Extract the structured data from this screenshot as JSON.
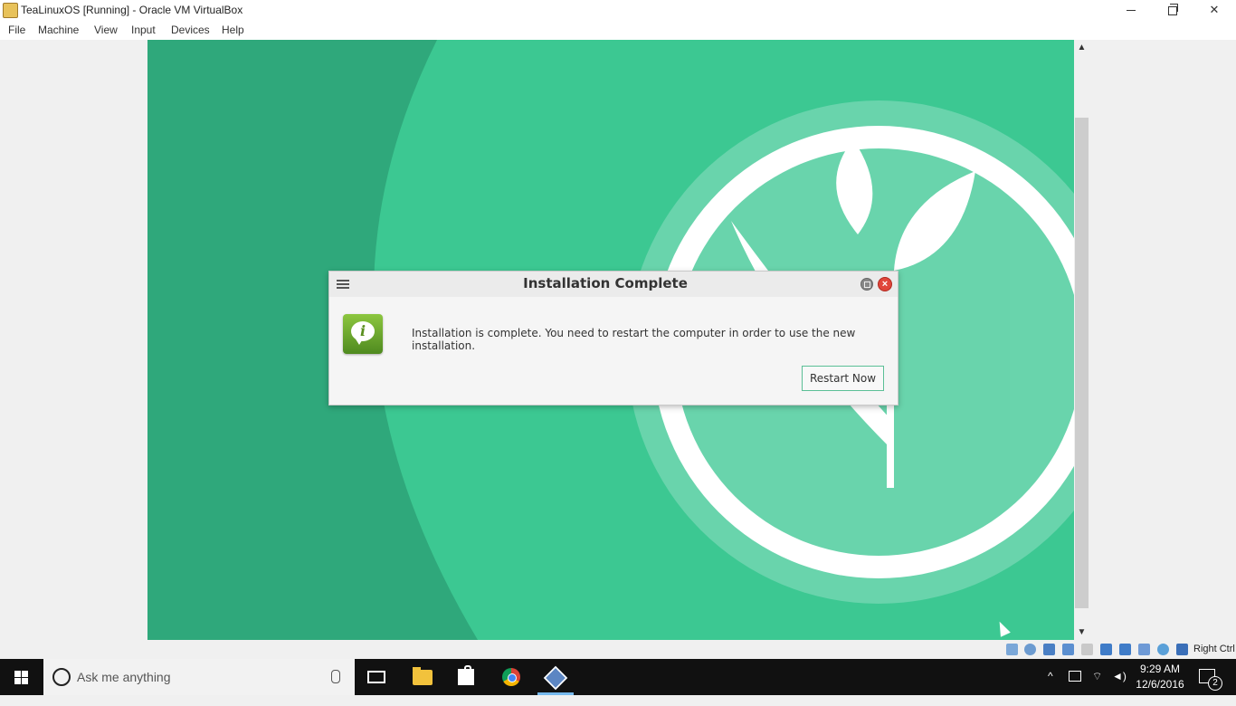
{
  "window": {
    "title": "TeaLinuxOS [Running] - Oracle VM VirtualBox",
    "minimize_label": "",
    "maximize_label": "",
    "close_label": "✕"
  },
  "menubar": {
    "items": [
      "File",
      "Machine",
      "View",
      "Input",
      "Devices",
      "Help"
    ]
  },
  "dialog": {
    "title": "Installation Complete",
    "message": "Installation is complete. You need to restart the computer in order to use the new installation.",
    "restart_button": "Restart Now",
    "close_glyph": "×",
    "icon_letter": "i"
  },
  "vbox_status": {
    "host_key": "Right Ctrl"
  },
  "taskbar": {
    "search_placeholder": "Ask me anything",
    "time": "9:29 AM",
    "date": "12/6/2016",
    "notification_count": "2"
  },
  "colors": {
    "wallpaper_dark": "#2fa87b",
    "wallpaper_mid": "#3cc892",
    "wallpaper_light": "#69d4ac",
    "button_border": "#5bbf96",
    "close_red": "#e0463b"
  }
}
